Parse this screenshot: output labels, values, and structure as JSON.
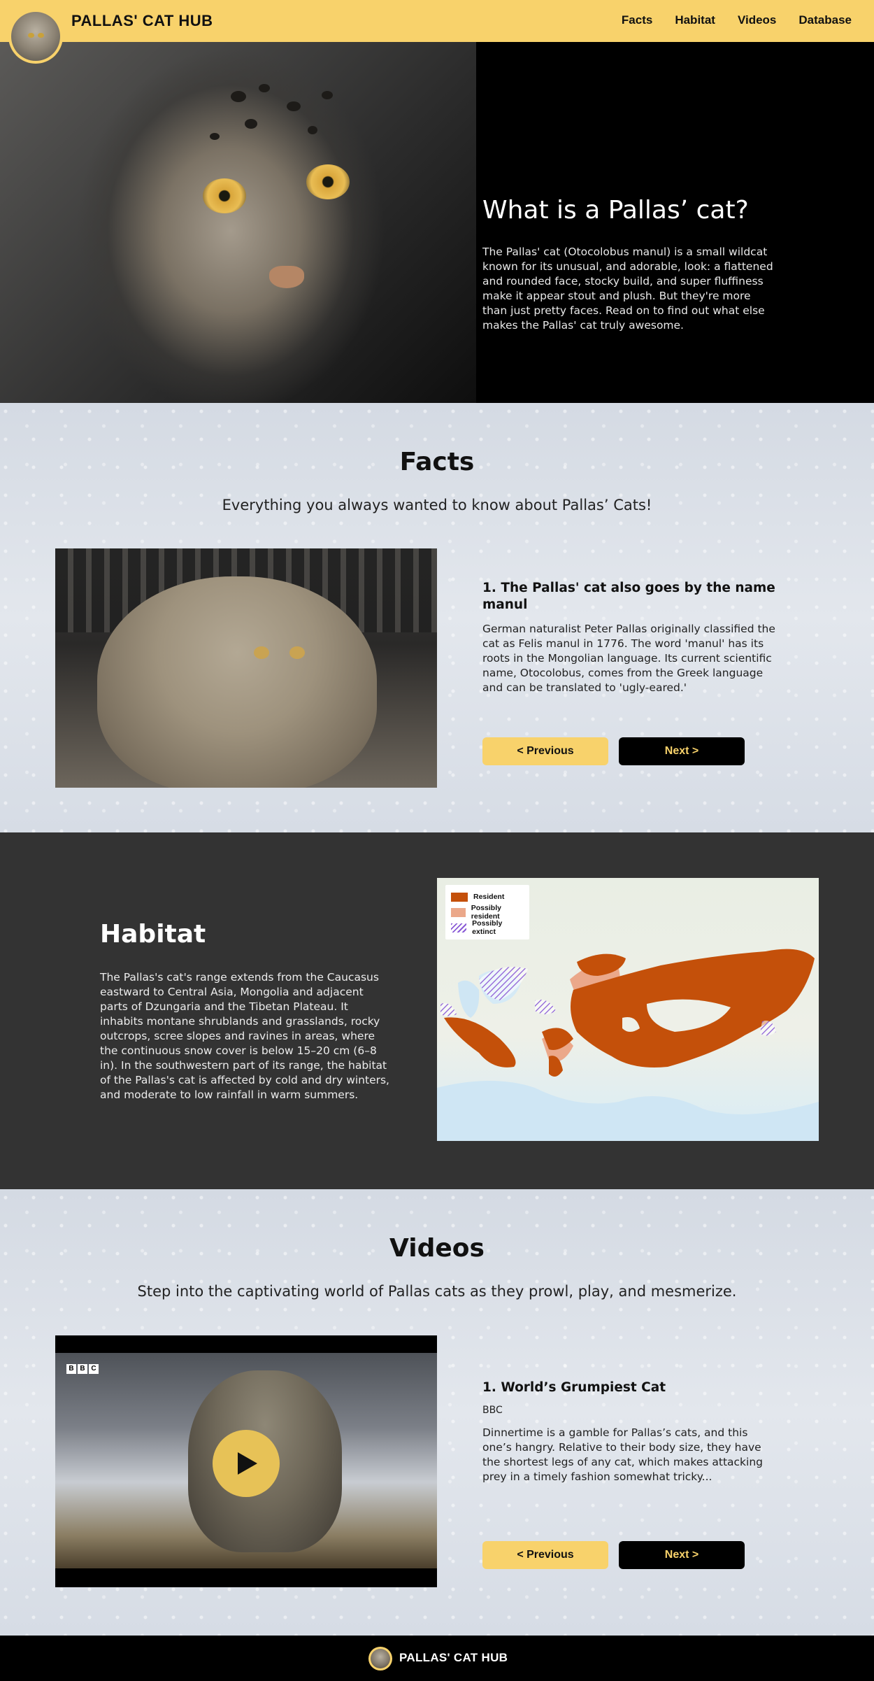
{
  "header": {
    "brand": "PALLAS' CAT HUB",
    "nav": [
      "Facts",
      "Habitat",
      "Videos",
      "Database"
    ],
    "accent_color": "#f8d26b"
  },
  "hero": {
    "title": "What is a Pallas’ cat?",
    "text": "The Pallas' cat (Otocolobus manul) is a small wildcat known for its unusual, and adorable, look: a flattened and rounded face, stocky build, and super fluffiness make it appear stout and plush. But they're more than just pretty faces. Read on to find out what else makes the Pallas' cat truly awesome."
  },
  "facts": {
    "title": "Facts",
    "subtitle": "Everything you always wanted to know about Pallas’ Cats!",
    "card": {
      "title": "1. The Pallas' cat also goes by the name manul",
      "text": "German naturalist Peter Pallas originally classified the cat as Felis manul in 1776. The word 'manul' has its roots in the Mongolian language. Its current scientific name, Otocolobus, comes from the Greek language and can be translated to 'ugly-eared.'"
    },
    "prev_label": "< Previous",
    "next_label": "Next >"
  },
  "habitat": {
    "title": "Habitat",
    "text": "The Pallas's cat's range extends from the Caucasus eastward to Central Asia, Mongolia and adjacent parts of Dzungaria and the Tibetan Plateau. It inhabits montane shrublands and grasslands, rocky outcrops, scree slopes and ravines in areas, where the continuous snow cover is below 15–20 cm (6–8 in). In the southwestern part of its range, the habitat of the Pallas's cat is affected by cold and dry winters, and moderate to low rainfall in warm summers.",
    "legend": [
      {
        "label": "Resident",
        "color": "#c4500a"
      },
      {
        "label": "Possibly resident",
        "color": "#eba88a"
      },
      {
        "label": "Possibly extinct",
        "color": "#8a5bd6"
      }
    ]
  },
  "videos": {
    "title": "Videos",
    "subtitle": "Step into the captivating world of Pallas cats as they prowl, play, and mesmerize.",
    "channel_logo": [
      "B",
      "B",
      "C"
    ],
    "card": {
      "title": "1. World’s Grumpiest Cat",
      "source": "BBC",
      "text": "Dinnertime is a gamble for Pallas’s cats, and this one’s hangry. Relative to their body size, they have the shortest legs of any cat, which makes attacking prey in a timely fashion somewhat tricky..."
    },
    "prev_label": "< Previous",
    "next_label": "Next >"
  },
  "footer": {
    "brand": "PALLAS' CAT HUB"
  }
}
